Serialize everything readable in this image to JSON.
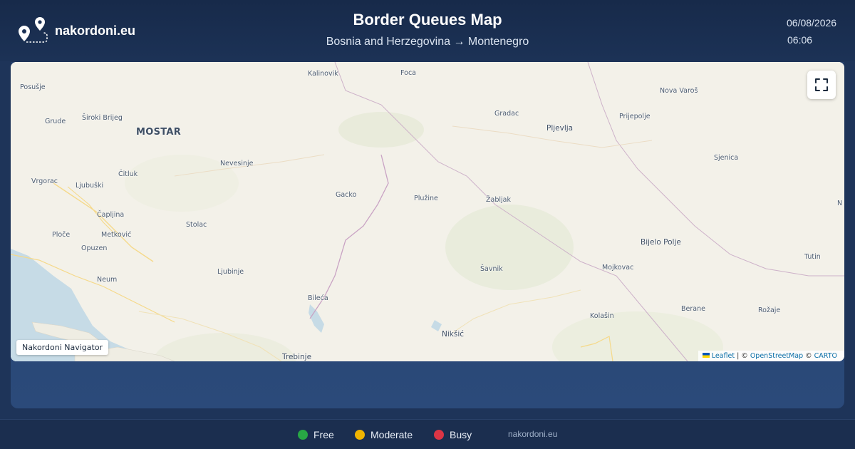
{
  "header": {
    "brand": "nakordoni.eu",
    "title": "Border Queues Map",
    "subtitle": "Bosnia and Herzegovina → Montenegro",
    "date": "06/08/2026",
    "time": "06:06"
  },
  "map": {
    "places": [
      {
        "name": "Kalinovik"
      },
      {
        "name": "Foca"
      },
      {
        "name": "Posušje"
      },
      {
        "name": "Nova Varoš"
      },
      {
        "name": "Grude"
      },
      {
        "name": "Široki Brijeg"
      },
      {
        "name": "Gradac"
      },
      {
        "name": "Prijepolje"
      },
      {
        "name": "MOSTAR"
      },
      {
        "name": "Pljevlja"
      },
      {
        "name": "Sjenica"
      },
      {
        "name": "Nevesinje"
      },
      {
        "name": "Čitluk"
      },
      {
        "name": "Vrgorac"
      },
      {
        "name": "Ljubuški"
      },
      {
        "name": "Gacko"
      },
      {
        "name": "Plužine"
      },
      {
        "name": "Žabljak"
      },
      {
        "name": "Čapljina"
      },
      {
        "name": "Stolac"
      },
      {
        "name": "Ploče"
      },
      {
        "name": "Metković"
      },
      {
        "name": "Opuzen"
      },
      {
        "name": "Bijelo Polje"
      },
      {
        "name": "Tutin"
      },
      {
        "name": "Šavnik"
      },
      {
        "name": "Mojkovac"
      },
      {
        "name": "Ljubinje"
      },
      {
        "name": "Neum"
      },
      {
        "name": "Bileća"
      },
      {
        "name": "Kolašin"
      },
      {
        "name": "Berane"
      },
      {
        "name": "Rožaje"
      },
      {
        "name": "Nikšić"
      },
      {
        "name": "Trebinje"
      },
      {
        "name": "N"
      }
    ],
    "navigator_label": "Nakordoni Navigator",
    "attribution": {
      "leaflet": "Leaflet",
      "sep1": " | © ",
      "osm": "OpenStreetMap",
      "sep2": " © ",
      "carto": "CARTO"
    }
  },
  "legend": {
    "items": [
      {
        "label": "Free",
        "color": "#28a745"
      },
      {
        "label": "Moderate",
        "color": "#f0b400"
      },
      {
        "label": "Busy",
        "color": "#dc3545"
      }
    ],
    "site": "nakordoni.eu"
  }
}
